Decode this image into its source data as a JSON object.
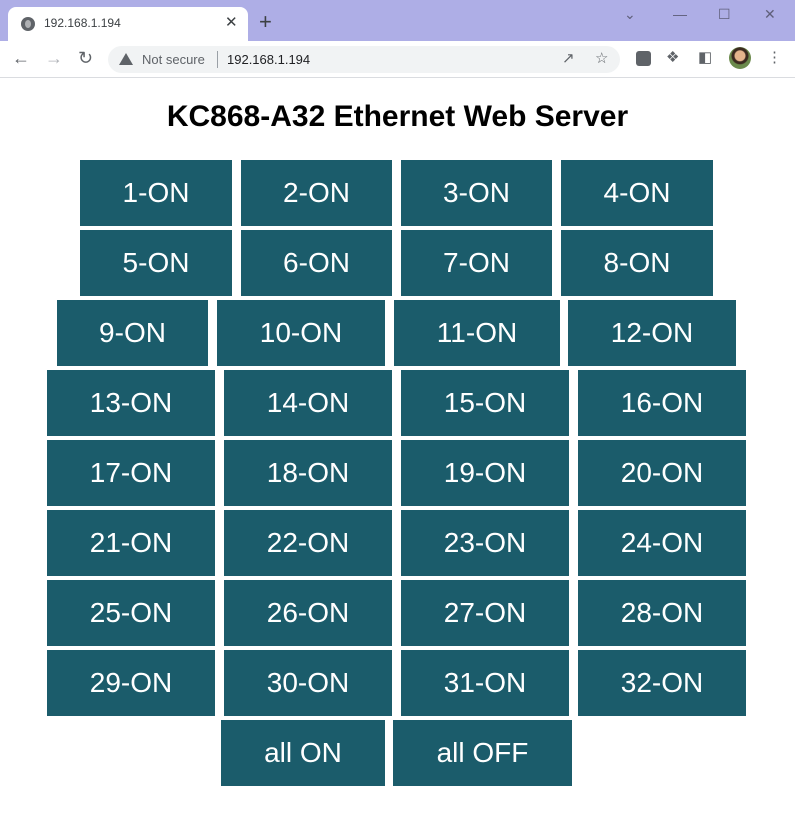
{
  "browser": {
    "tab_title": "192.168.1.194",
    "tab_close": "✕",
    "new_tab": "+",
    "security_label": "Not secure",
    "url": "192.168.1.194"
  },
  "page": {
    "title": "KC868-A32 Ethernet Web Server",
    "buttons": [
      "1-ON",
      "2-ON",
      "3-ON",
      "4-ON",
      "5-ON",
      "6-ON",
      "7-ON",
      "8-ON",
      "9-ON",
      "10-ON",
      "11-ON",
      "12-ON",
      "13-ON",
      "14-ON",
      "15-ON",
      "16-ON",
      "17-ON",
      "18-ON",
      "19-ON",
      "20-ON",
      "21-ON",
      "22-ON",
      "23-ON",
      "24-ON",
      "25-ON",
      "26-ON",
      "27-ON",
      "28-ON",
      "29-ON",
      "30-ON",
      "31-ON",
      "32-ON",
      "all ON",
      "all OFF"
    ],
    "button_color": "#1b5c6b"
  }
}
